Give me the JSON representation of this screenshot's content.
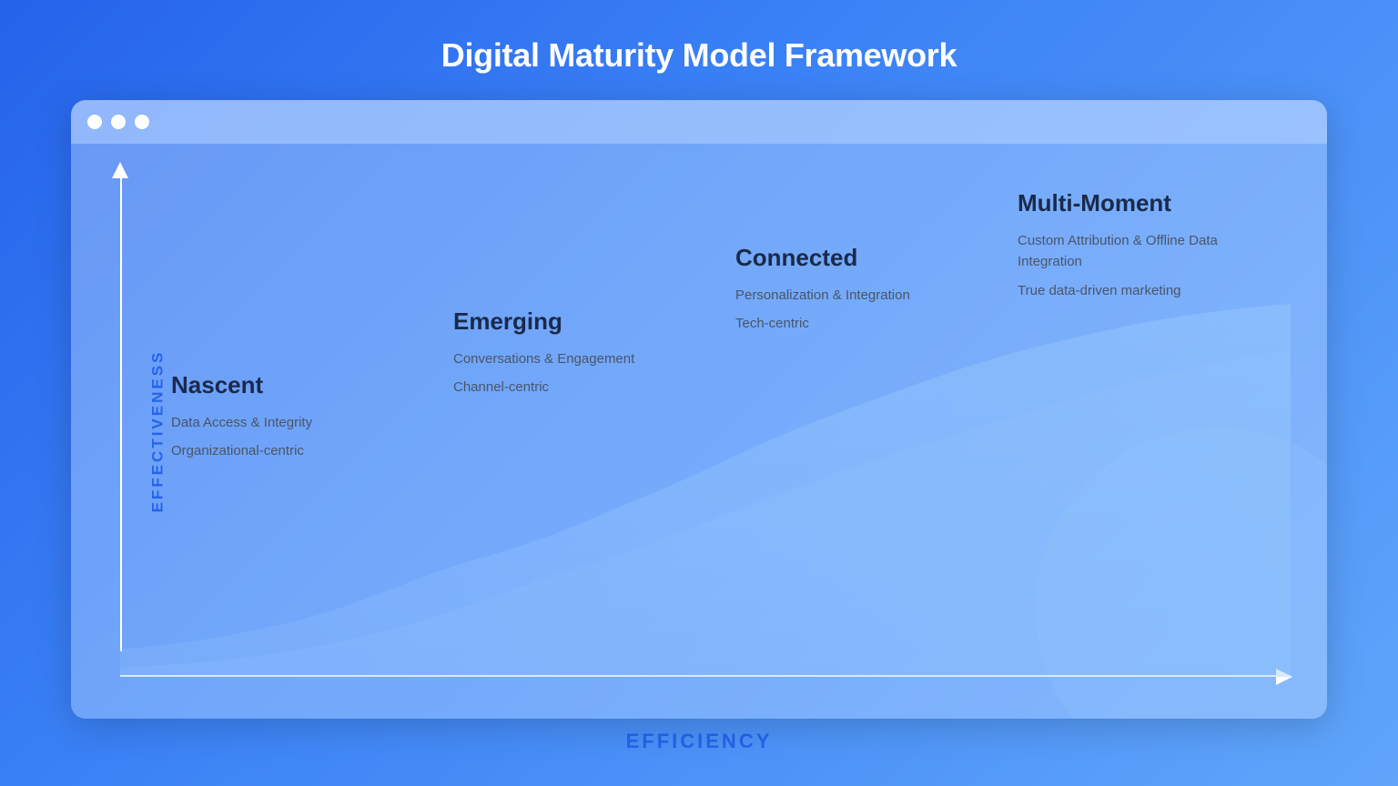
{
  "page": {
    "title": "Digital Maturity Model Framework",
    "efficiency_label": "EFFICIENCY",
    "y_axis_label": "EFFECTIVENESS"
  },
  "browser": {
    "dots": [
      "dot1",
      "dot2",
      "dot3"
    ]
  },
  "stages": [
    {
      "id": "nascent",
      "title": "Nascent",
      "descriptions": [
        "Data Access & Integrity",
        "Organizational-centric"
      ]
    },
    {
      "id": "emerging",
      "title": "Emerging",
      "descriptions": [
        "Conversations & Engagement",
        "Channel-centric"
      ]
    },
    {
      "id": "connected",
      "title": "Connected",
      "descriptions": [
        "Personalization & Integration",
        "Tech-centric"
      ]
    },
    {
      "id": "multimoment",
      "title": "Multi-Moment",
      "descriptions": [
        "Custom Attribution & Offline Data Integration",
        "True data-driven marketing"
      ]
    }
  ]
}
